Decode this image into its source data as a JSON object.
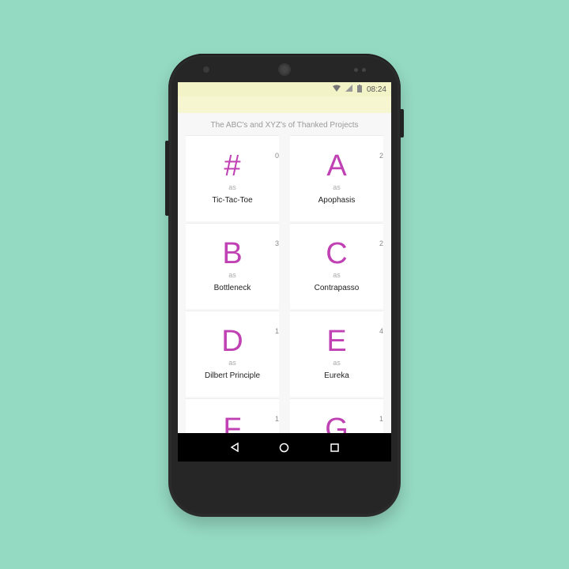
{
  "status": {
    "time": "08:24",
    "icons": [
      "wifi-icon",
      "signal-icon",
      "battery-icon"
    ]
  },
  "page": {
    "title": "The ABC's and XYZ's of Thanked Projects"
  },
  "items": [
    {
      "letter": "#",
      "as_label": "as",
      "name": "Tic-Tac-Toe",
      "count": "0"
    },
    {
      "letter": "A",
      "as_label": "as",
      "name": "Apophasis",
      "count": "2"
    },
    {
      "letter": "B",
      "as_label": "as",
      "name": "Bottleneck",
      "count": "3"
    },
    {
      "letter": "C",
      "as_label": "as",
      "name": "Contrapasso",
      "count": "2"
    },
    {
      "letter": "D",
      "as_label": "as",
      "name": "Dilbert Principle",
      "count": "1"
    },
    {
      "letter": "E",
      "as_label": "as",
      "name": "Eureka",
      "count": "4"
    },
    {
      "letter": "F",
      "as_label": "",
      "name": "",
      "count": "1"
    },
    {
      "letter": "G",
      "as_label": "",
      "name": "",
      "count": "1"
    }
  ],
  "nav": {
    "icons": [
      "back-icon",
      "home-icon",
      "recents-icon"
    ]
  },
  "colors": {
    "accent": "#c041b3",
    "background": "#94d9c2",
    "statusbar": "#f3f3c8"
  }
}
